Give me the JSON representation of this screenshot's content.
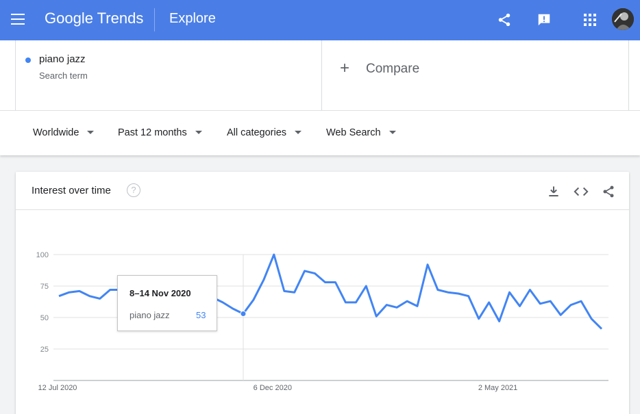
{
  "header": {
    "logo_google": "Google",
    "logo_trends": "Trends",
    "section": "Explore"
  },
  "search": {
    "term": "piano jazz",
    "term_type": "Search term",
    "term_color": "#4285f4",
    "compare_label": "Compare"
  },
  "filters": [
    {
      "label": "Worldwide"
    },
    {
      "label": "Past 12 months"
    },
    {
      "label": "All categories"
    },
    {
      "label": "Web Search"
    }
  ],
  "card": {
    "title": "Interest over time",
    "help": "?"
  },
  "tooltip": {
    "date": "8–14 Nov 2020",
    "term": "piano jazz",
    "value": "53"
  },
  "icons": {
    "menu": "menu-icon",
    "share": "share-icon",
    "feedback": "feedback-icon",
    "apps": "apps-icon",
    "download": "download-icon",
    "embed": "embed-icon"
  },
  "chart_data": {
    "type": "line",
    "title": "Interest over time",
    "ylim": [
      0,
      100
    ],
    "yticks": [
      25,
      50,
      75,
      100
    ],
    "xtick_labels": [
      "12 Jul 2020",
      "6 Dec 2020",
      "2 May 2021"
    ],
    "xtick_index": [
      0,
      21,
      43
    ],
    "highlight_index": 18,
    "grid": true,
    "series": [
      {
        "name": "piano jazz",
        "color": "#4285f4",
        "values": [
          67,
          70,
          71,
          67,
          65,
          72,
          72,
          62,
          69,
          66,
          62,
          62,
          81,
          62,
          62,
          66,
          62,
          57,
          53,
          64,
          80,
          100,
          71,
          70,
          87,
          85,
          78,
          78,
          62,
          62,
          75,
          51,
          60,
          58,
          63,
          59,
          92,
          72,
          70,
          69,
          67,
          49,
          62,
          47,
          70,
          59,
          72,
          61,
          63,
          52,
          60,
          63,
          49,
          41
        ]
      }
    ]
  }
}
